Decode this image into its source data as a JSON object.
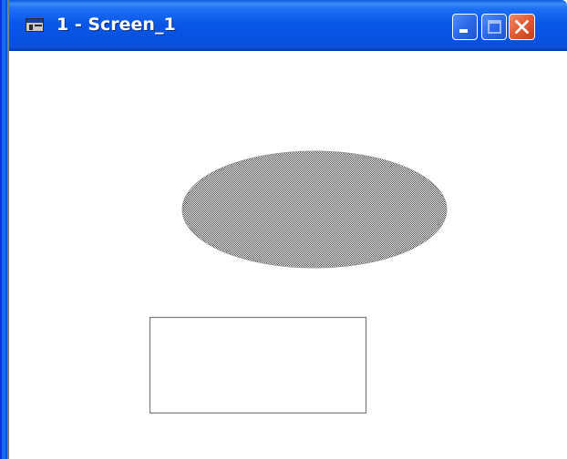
{
  "window": {
    "title": "1 - Screen_1",
    "icon": "screen-app-icon"
  },
  "titlebar_buttons": [
    {
      "name": "minimize",
      "icon": "minimize-icon"
    },
    {
      "name": "maximize",
      "icon": "maximize-icon",
      "state": "disabled"
    },
    {
      "name": "close",
      "icon": "close-icon"
    }
  ],
  "shapes": [
    {
      "type": "ellipse",
      "fill": "checkered-gray",
      "stroke": "#9a9a9a"
    },
    {
      "type": "rectangle",
      "fill": "#ffffff",
      "stroke": "#7a7a7a"
    }
  ],
  "colors": {
    "titlebar": "#0a56e6",
    "close_button": "#e25a33",
    "pattern_dark": "#4a4a4a",
    "pattern_light": "#ffffff"
  }
}
